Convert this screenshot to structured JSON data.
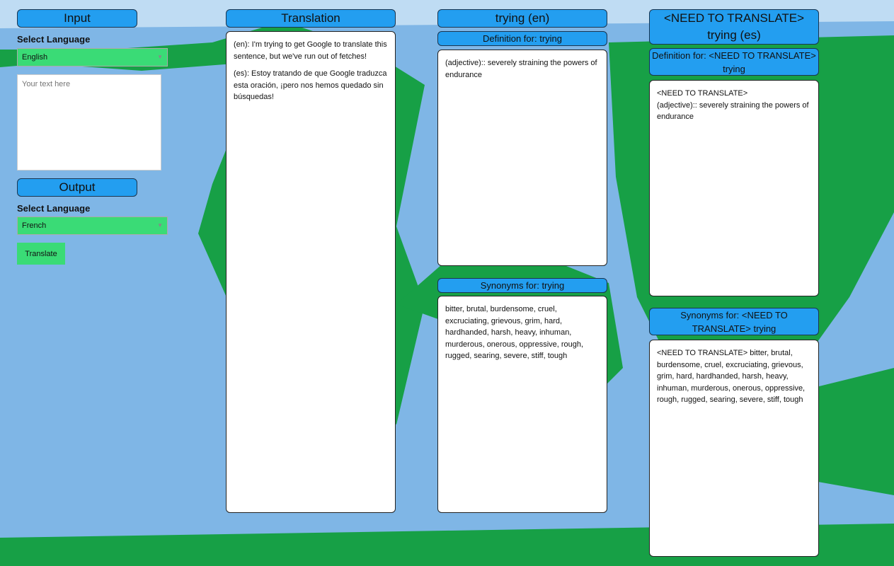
{
  "input": {
    "header": "Input",
    "select_label": "Select Language",
    "language": "English",
    "textarea_placeholder": "Your text here"
  },
  "output": {
    "header": "Output",
    "select_label": "Select Language",
    "language": "French",
    "translate_button": "Translate"
  },
  "translation": {
    "header": "Translation",
    "en": "(en): I'm trying to get Google to translate this sentence, but we've run out of fetches!",
    "es": "(es): Estoy tratando de que Google traduzca esta oración, ¡pero nos hemos quedado sin búsquedas!"
  },
  "source_word": {
    "header": "trying (en)",
    "definition_header": "Definition for: trying",
    "definition": "(adjective):: severely straining the powers of endurance",
    "synonyms_header": "Synonyms for: trying",
    "synonyms": "bitter, brutal, burdensome, cruel, excruciating, grievous, grim, hard, hardhanded, harsh, heavy, inhuman, murderous, onerous, oppressive, rough, rugged, searing, severe, stiff, tough"
  },
  "target_word": {
    "header": "<NEED TO TRANSLATE> trying (es)",
    "definition_header": "Definition for: <NEED TO TRANSLATE> trying",
    "definition_prefix": "<NEED TO TRANSLATE>",
    "definition": "(adjective):: severely straining the powers of endurance",
    "synonyms_header": "Synonyms for: <NEED TO TRANSLATE> trying",
    "synonyms": "<NEED TO TRANSLATE> bitter, brutal, burdensome, cruel, excruciating, grievous, grim, hard, hardhanded, harsh, heavy, inhuman, murderous, onerous, oppressive, rough, rugged, searing, severe, stiff, tough"
  },
  "colors": {
    "header": "#239ef0",
    "select": "#3adb76",
    "ocean": "#7fb6e6",
    "land": "#17a046"
  }
}
